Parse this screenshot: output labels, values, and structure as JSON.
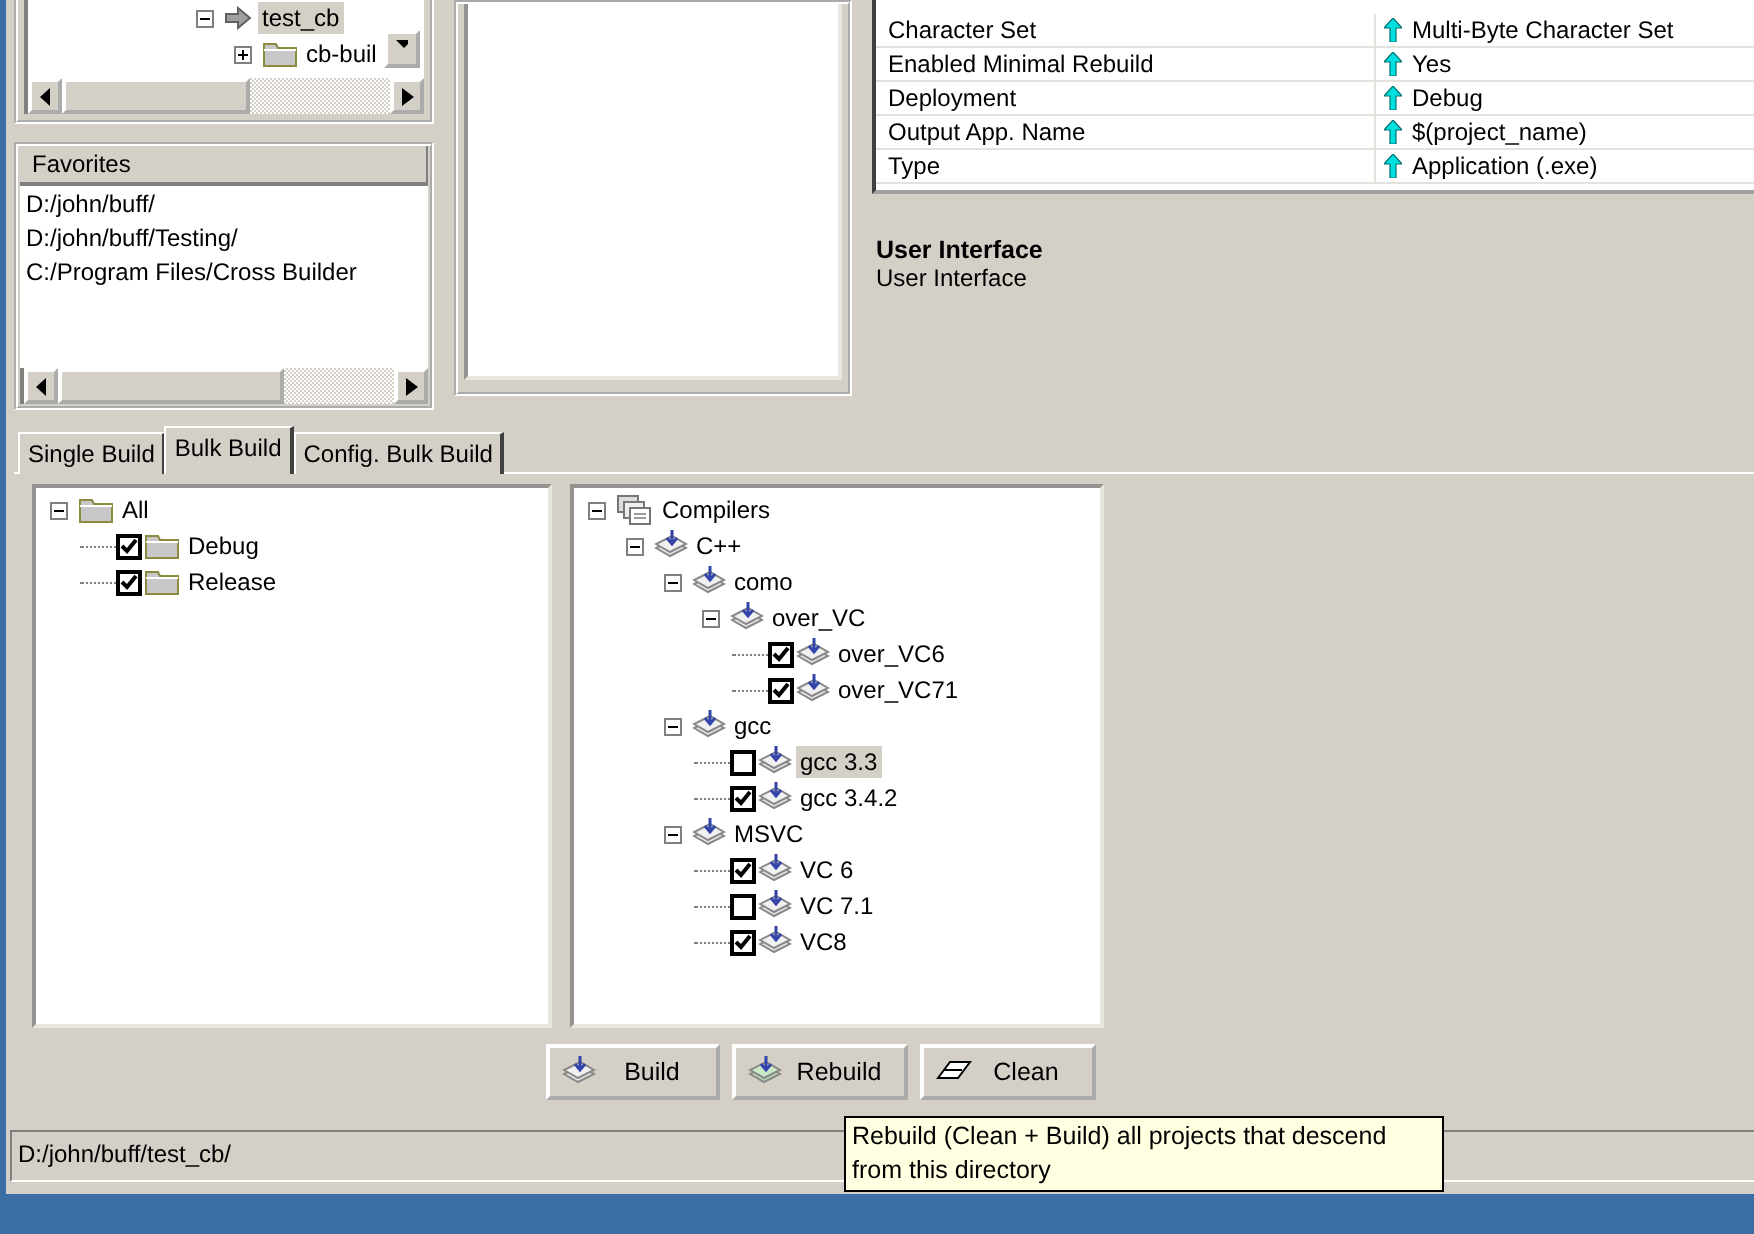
{
  "explorer_tree": [
    {
      "label": "test_cb",
      "kind": "current",
      "expanded": true,
      "selected": true
    },
    {
      "label": "cb-buil",
      "kind": "folder",
      "expanded": false,
      "selected": false
    }
  ],
  "favorites": {
    "title": "Favorites",
    "items": [
      "D:/john/buff/",
      "D:/john/buff/Testing/",
      "C:/Program Files/Cross Builder"
    ]
  },
  "properties": [
    {
      "name": "Character Set",
      "value": "Multi-Byte Character Set"
    },
    {
      "name": "Enabled Minimal Rebuild",
      "value": "Yes"
    },
    {
      "name": "Deployment",
      "value": "Debug"
    },
    {
      "name": "Output App. Name",
      "value": "$(project_name)"
    },
    {
      "name": "Type",
      "value": "Application (.exe)"
    }
  ],
  "description": {
    "title": "User Interface",
    "text": "User Interface"
  },
  "tabs": [
    {
      "label": "Single Build",
      "selected": false
    },
    {
      "label": "Bulk Build",
      "selected": true
    },
    {
      "label": "Config. Bulk Build",
      "selected": false
    }
  ],
  "config_tree": [
    {
      "label": "All",
      "kind": "folder",
      "expanded": true,
      "selected": false,
      "children": [
        {
          "label": "Debug",
          "kind": "folder-option",
          "checked": true,
          "selected": false
        },
        {
          "label": "Release",
          "kind": "folder-option",
          "checked": true,
          "selected": false
        }
      ]
    }
  ],
  "compiler_tree": [
    {
      "label": "Compilers",
      "kind": "root",
      "expanded": true,
      "selected": false,
      "children": [
        {
          "label": "C++",
          "kind": "group",
          "expanded": true,
          "selected": false,
          "children": [
            {
              "label": "como",
              "kind": "group",
              "expanded": true,
              "selected": false,
              "children": [
                {
                  "label": "over_VC",
                  "kind": "group",
                  "expanded": true,
                  "selected": false,
                  "children": [
                    {
                      "label": "over_VC6",
                      "kind": "option",
                      "checked": true,
                      "selected": false
                    },
                    {
                      "label": "over_VC71",
                      "kind": "option",
                      "checked": true,
                      "selected": false
                    }
                  ]
                }
              ]
            },
            {
              "label": "gcc",
              "kind": "group",
              "expanded": true,
              "selected": false,
              "children": [
                {
                  "label": "gcc 3.3",
                  "kind": "option",
                  "checked": false,
                  "selected": true
                },
                {
                  "label": "gcc 3.4.2",
                  "kind": "option",
                  "checked": true,
                  "selected": false
                }
              ]
            },
            {
              "label": "MSVC",
              "kind": "group",
              "expanded": true,
              "selected": false,
              "children": [
                {
                  "label": "VC 6",
                  "kind": "option",
                  "checked": true,
                  "selected": false
                },
                {
                  "label": "VC 7.1",
                  "kind": "option",
                  "checked": false,
                  "selected": false
                },
                {
                  "label": "VC8",
                  "kind": "option",
                  "checked": true,
                  "selected": false
                }
              ]
            }
          ]
        }
      ]
    }
  ],
  "buttons": [
    {
      "label": "Build",
      "kind": "build"
    },
    {
      "label": "Rebuild",
      "kind": "rebuild"
    },
    {
      "label": "Clean",
      "kind": "clean"
    }
  ],
  "status_bar": "D:/john/buff/test_cb/",
  "tooltip": "Rebuild (Clean + Build) all projects that descend from this directory"
}
